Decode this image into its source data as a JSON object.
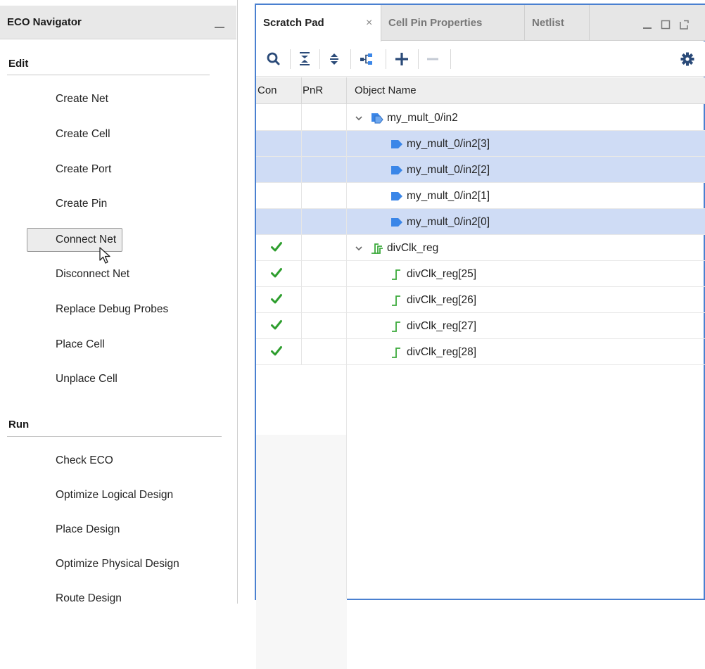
{
  "eco_navigator": {
    "title": "ECO Navigator",
    "sections": [
      {
        "label": "Edit",
        "items": [
          "Create Net",
          "Create Cell",
          "Create Port",
          "Create Pin",
          "Connect Net",
          "Disconnect Net",
          "Replace Debug Probes",
          "Place Cell",
          "Unplace Cell"
        ]
      },
      {
        "label": "Run",
        "items": [
          "Check ECO",
          "Optimize Logical Design",
          "Place Design",
          "Optimize Physical Design",
          "Route Design"
        ]
      }
    ],
    "hovered_item": "Connect Net"
  },
  "scratch_pad": {
    "tabs": [
      {
        "label": "Scratch Pad",
        "active": true
      },
      {
        "label": "Cell Pin Properties",
        "active": false
      },
      {
        "label": "Netlist",
        "active": false
      }
    ],
    "tab_close_glyph": "×",
    "window_controls": [
      "minimize-icon",
      "restore-icon",
      "float-icon"
    ],
    "toolbar": [
      "search-icon",
      "collapse-all-icon",
      "expand-all-icon",
      "hierarchy-icon",
      "add-icon",
      "remove-icon",
      "gear-icon"
    ],
    "columns": [
      "Con",
      "PnR",
      "Object Name"
    ],
    "rows": [
      {
        "con": false,
        "indent": 0,
        "expander": true,
        "icon": "bus-pin-icon",
        "name": "my_mult_0/in2",
        "selected": false
      },
      {
        "con": false,
        "indent": 1,
        "expander": false,
        "icon": "pin-icon",
        "name": "my_mult_0/in2[3]",
        "selected": true
      },
      {
        "con": false,
        "indent": 1,
        "expander": false,
        "icon": "pin-icon",
        "name": "my_mult_0/in2[2]",
        "selected": true
      },
      {
        "con": false,
        "indent": 1,
        "expander": false,
        "icon": "pin-icon",
        "name": "my_mult_0/in2[1]",
        "selected": false
      },
      {
        "con": false,
        "indent": 1,
        "expander": false,
        "icon": "pin-icon",
        "name": "my_mult_0/in2[0]",
        "selected": true
      },
      {
        "con": true,
        "indent": 0,
        "expander": true,
        "icon": "register-bus-icon",
        "name": "divClk_reg",
        "selected": false
      },
      {
        "con": true,
        "indent": 1,
        "expander": false,
        "icon": "register-icon",
        "name": "divClk_reg[25]",
        "selected": false
      },
      {
        "con": true,
        "indent": 1,
        "expander": false,
        "icon": "register-icon",
        "name": "divClk_reg[26]",
        "selected": false
      },
      {
        "con": true,
        "indent": 1,
        "expander": false,
        "icon": "register-icon",
        "name": "divClk_reg[27]",
        "selected": false
      },
      {
        "con": true,
        "indent": 1,
        "expander": false,
        "icon": "register-icon",
        "name": "divClk_reg[28]",
        "selected": false
      }
    ],
    "colors": {
      "accent_border": "#4a80d0",
      "selected_row": "#cfdcf5",
      "check_green": "#2e9e2e",
      "pin_blue": "#3a86e8",
      "register_green": "#3caa3c"
    }
  }
}
